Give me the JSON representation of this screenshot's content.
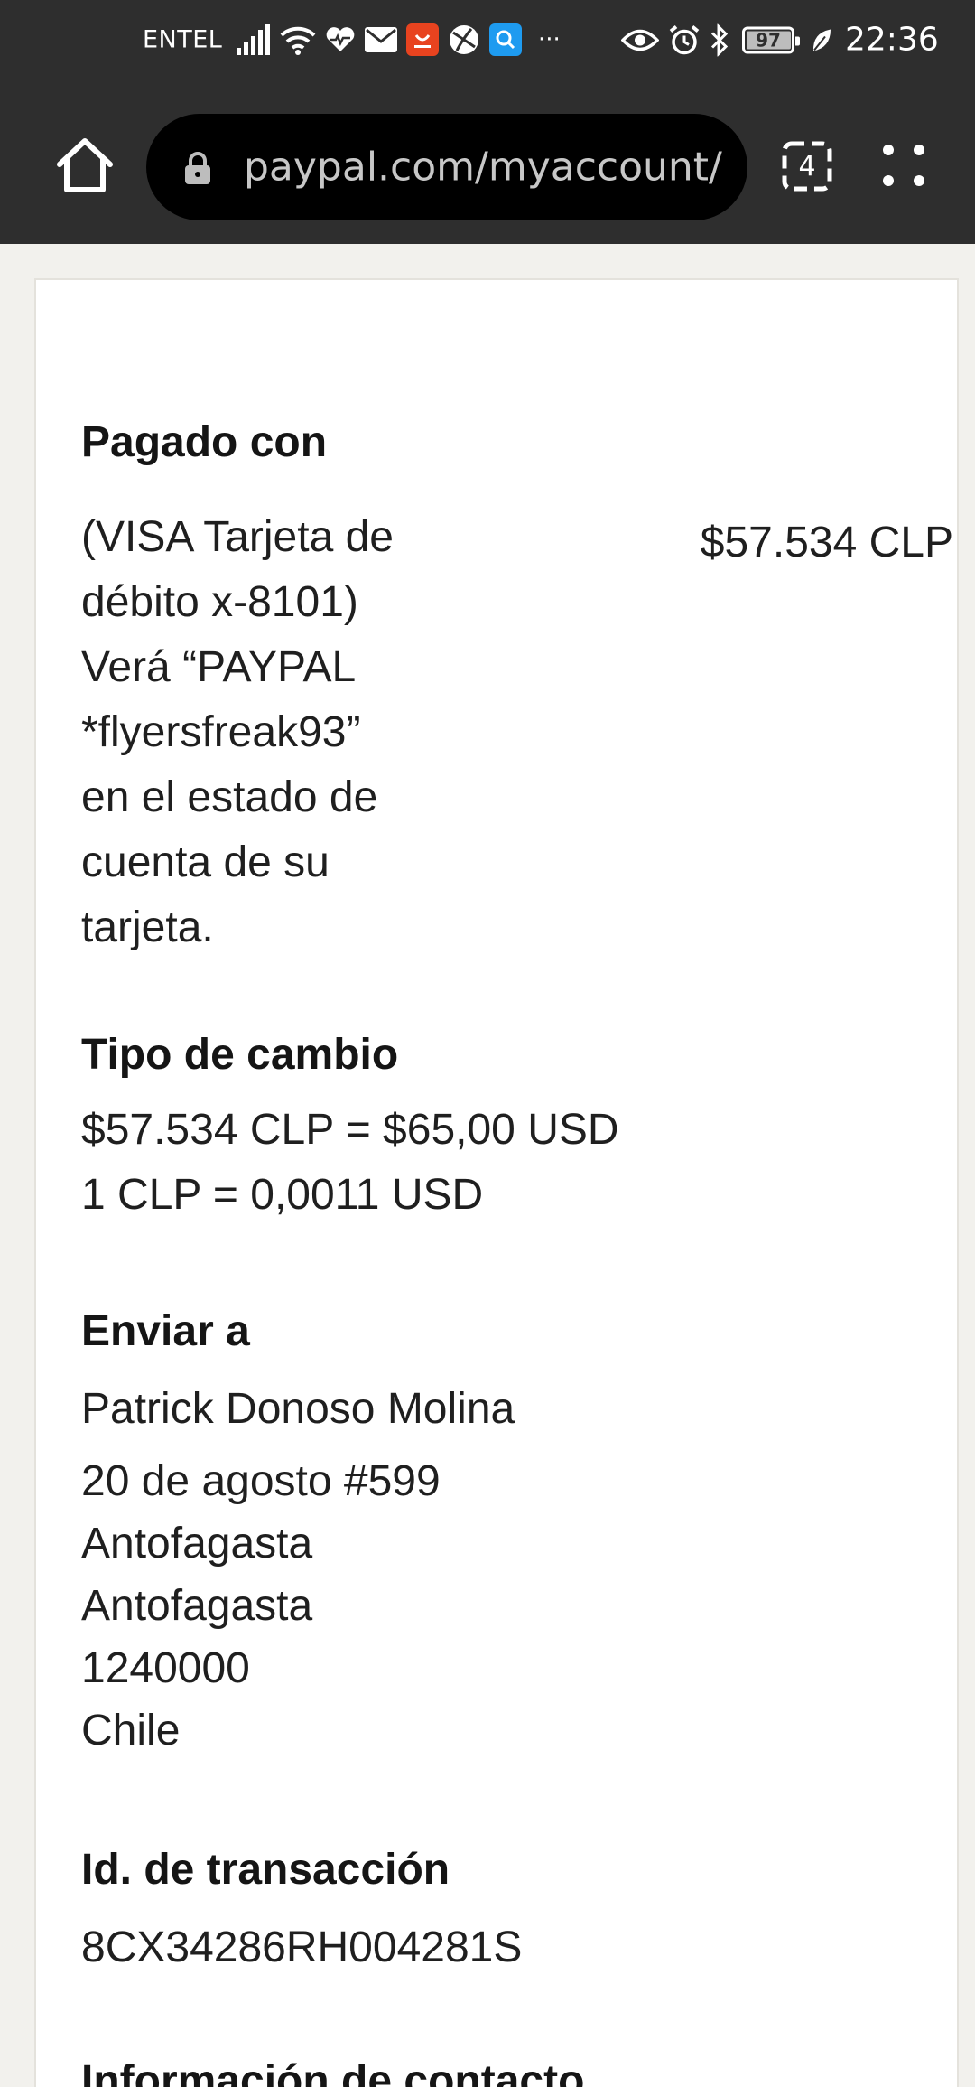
{
  "status_bar": {
    "carrier": "ENTEL",
    "battery_level": "97",
    "clock": "22:36",
    "overflow_indicator": "···",
    "icons_left": [
      "signal-icon",
      "wifi-icon",
      "health-heart-icon",
      "mail-icon",
      "shopping-app-icon",
      "browser-app-icon",
      "search-app-icon"
    ],
    "icons_right": [
      "eye-icon",
      "alarm-icon",
      "bluetooth-icon",
      "battery-icon",
      "leaf-icon"
    ]
  },
  "browser": {
    "url": "paypal.com/myaccount/a",
    "tab_count": "4",
    "icons": [
      "home-icon",
      "lock-icon",
      "tabs-icon",
      "menu-icon"
    ]
  },
  "details": {
    "paid_with": {
      "heading": "Pagado con",
      "method_lines": [
        "(VISA Tarjeta de",
        "débito x-8101)",
        "Verá “PAYPAL",
        "*flyersfreak93”",
        "en el estado de",
        "cuenta de su",
        "tarjeta."
      ],
      "amount": "$57.534 CLP"
    },
    "exchange_rate": {
      "heading": "Tipo de cambio",
      "line1": "$57.534 CLP = $65,00 USD",
      "line2": "1 CLP = 0,0011 USD"
    },
    "ship_to": {
      "heading": "Enviar a",
      "name": "Patrick Donoso Molina",
      "address_lines": [
        "20 de agosto #599",
        "Antofagasta",
        "Antofagasta",
        "1240000",
        "Chile"
      ]
    },
    "transaction": {
      "heading": "Id. de transacción",
      "id": "8CX34286RH004281S"
    },
    "contact": {
      "heading": "Información de contacto"
    }
  }
}
